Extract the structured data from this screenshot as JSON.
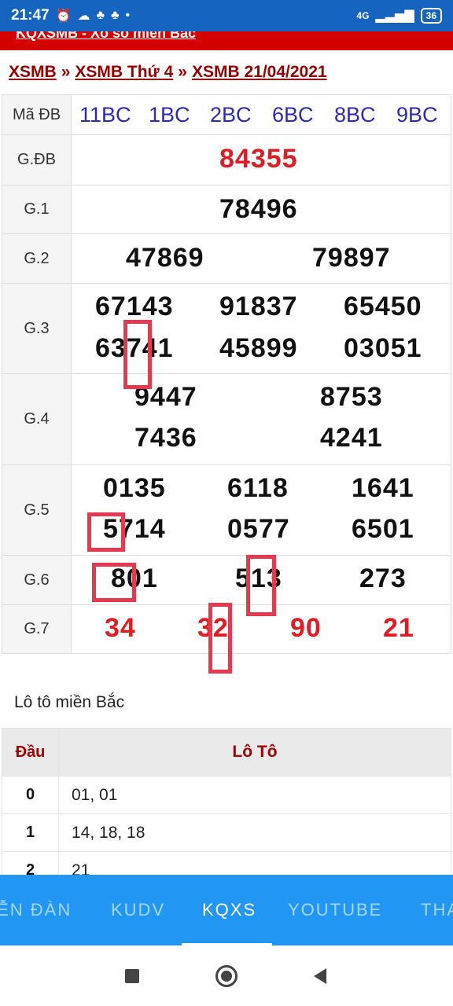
{
  "status_bar": {
    "time": "21:47",
    "network": "4G",
    "battery": "36"
  },
  "banner": {
    "text": "KQXSMB - Xổ số miền Bắc"
  },
  "breadcrumb": {
    "item1": "XSMB",
    "sep": "»",
    "item2": "XSMB Thứ 4",
    "item3": "XSMB 21/04/2021"
  },
  "results": {
    "ma_db_label": "Mã ĐB",
    "ma_db_codes": [
      "11BC",
      "1BC",
      "2BC",
      "6BC",
      "8BC",
      "9BC"
    ],
    "prizes": [
      {
        "label": "G.ĐB",
        "numbers": [
          "84355"
        ]
      },
      {
        "label": "G.1",
        "numbers": [
          "78496"
        ]
      },
      {
        "label": "G.2",
        "numbers": [
          "47869",
          "79897"
        ]
      },
      {
        "label": "G.3",
        "numbers": [
          "67143",
          "91837",
          "65450",
          "63741",
          "45899",
          "03051"
        ]
      },
      {
        "label": "G.4",
        "numbers": [
          "9447",
          "8753",
          "7436",
          "4241"
        ]
      },
      {
        "label": "G.5",
        "numbers": [
          "0135",
          "6118",
          "1641",
          "5714",
          "0577",
          "6501"
        ]
      },
      {
        "label": "G.6",
        "numbers": [
          "801",
          "513",
          "273"
        ]
      },
      {
        "label": "G.7",
        "numbers": [
          "34",
          "32",
          "90",
          "21"
        ]
      }
    ]
  },
  "loto": {
    "title": "Lô tô miền Bắc",
    "head_dau": "Đầu",
    "head_loto": "Lô Tô",
    "rows": [
      {
        "dau": "0",
        "values": "01, 01"
      },
      {
        "dau": "1",
        "values": "14, 18, 18"
      },
      {
        "dau": "2",
        "values": "21"
      }
    ]
  },
  "tabs": [
    "IỄN ĐÀN",
    "KUDV",
    "KQXS",
    "YOUTUBE",
    "THA"
  ],
  "active_tab": "KQXS",
  "colors": {
    "tab_bar": "#2196f3",
    "status_bar": "#1565c0",
    "banner": "#d50000",
    "special_prize": "#e01b24",
    "code_blue": "#2b2bb8",
    "breadcrumb": "#990000",
    "highlight": "#e53950"
  }
}
